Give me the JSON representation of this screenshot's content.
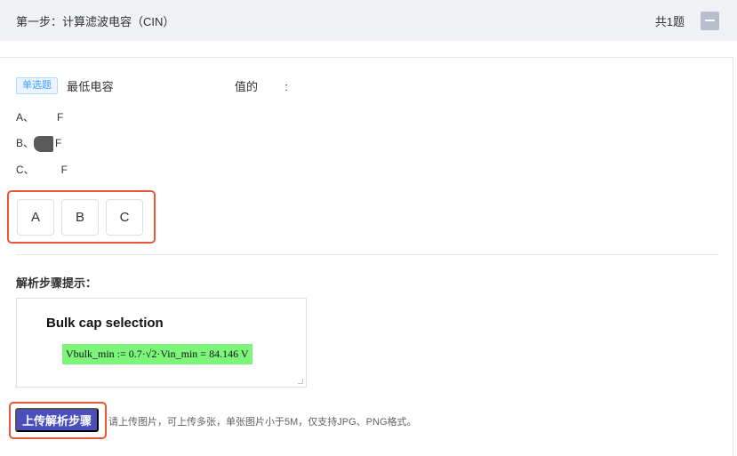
{
  "header": {
    "title": "第一步：计算滤波电容（CIN）",
    "count": "共1题"
  },
  "question": {
    "type_tag": "单选题",
    "text_start": "最低电容",
    "text_mid": "值的",
    "text_end": ":",
    "options": [
      {
        "prefix": "A、",
        "unit": "F"
      },
      {
        "prefix": "B、",
        "unit": "F"
      },
      {
        "prefix": "C、",
        "unit": "F"
      }
    ],
    "answers": [
      "A",
      "B",
      "C"
    ]
  },
  "hint": {
    "label": "解析步骤提示：",
    "image_title": "Bulk cap selection",
    "formula": "Vbulk_min := 0.7·√2·Vin_min = 84.146 V"
  },
  "upload": {
    "button_label": "上传解析步骤",
    "tip": "请上传图片，可上传多张，单张图片小于5M，仅支持JPG、PNG格式。"
  },
  "colors": {
    "accent": "#4a4fbd",
    "highlight": "#e8573a",
    "tag": "#409eff",
    "formula_bg": "#7cf57a"
  }
}
